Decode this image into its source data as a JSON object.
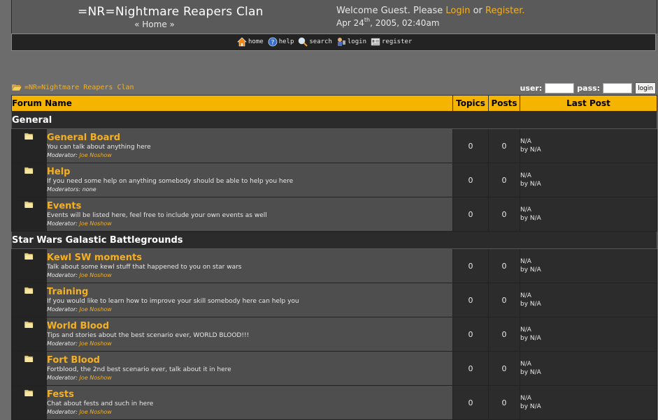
{
  "header": {
    "site_title": "=NR=Nightmare Reapers Clan",
    "home_link": "« Home »",
    "welcome_prefix": "Welcome Guest. Please ",
    "login_link": "Login",
    "or_text": " or ",
    "register_link": "Register.",
    "date_main": "Apr 24",
    "date_suffix": "th",
    "date_rest": ", 2005, 02:40am"
  },
  "nav": [
    {
      "label": "home",
      "icon": "home-icon"
    },
    {
      "label": "help",
      "icon": "help-icon"
    },
    {
      "label": "search",
      "icon": "search-icon"
    },
    {
      "label": "login",
      "icon": "login-icon"
    },
    {
      "label": "register",
      "icon": "register-icon"
    }
  ],
  "breadcrumb": {
    "text": "=NR=Nightmare Reapers Clan"
  },
  "login_form": {
    "user_label": "user:",
    "pass_label": "pass:",
    "button": "login"
  },
  "table_headers": {
    "forum_name": "Forum Name",
    "topics": "Topics",
    "posts": "Posts",
    "last_post": "Last Post"
  },
  "categories": [
    {
      "name": "General",
      "forums": [
        {
          "title": "General Board",
          "desc": "You can talk about anything here",
          "mod_label": "Moderator:",
          "mod": "Joe Noshow",
          "topics": "0",
          "posts": "0",
          "last1": "N/A",
          "last2": "by N/A"
        },
        {
          "title": "Help",
          "desc": "If you need some help on anything somebody should be able to help you here",
          "mod_label": "Moderators:",
          "mod": "none",
          "topics": "0",
          "posts": "0",
          "last1": "N/A",
          "last2": "by N/A"
        },
        {
          "title": "Events",
          "desc": "Events will be listed here, feel free to include your own events as well",
          "mod_label": "Moderator:",
          "mod": "Joe Noshow",
          "topics": "0",
          "posts": "0",
          "last1": "N/A",
          "last2": "by N/A"
        }
      ]
    },
    {
      "name": "Star Wars Galastic Battlegrounds",
      "forums": [
        {
          "title": "Kewl SW moments",
          "desc": "Talk about some kewl stuff that happened to you on star wars",
          "mod_label": "Moderator:",
          "mod": "Joe Noshow",
          "topics": "0",
          "posts": "0",
          "last1": "N/A",
          "last2": "by N/A"
        },
        {
          "title": "Training",
          "desc": "If you would like to learn how to improve your skill somebody here can help you",
          "mod_label": "Moderator:",
          "mod": "Joe Noshow",
          "topics": "0",
          "posts": "0",
          "last1": "N/A",
          "last2": "by N/A"
        },
        {
          "title": "World Blood",
          "desc": "Tips and stories about the best scenario ever, WORLD BLOOD!!!",
          "mod_label": "Moderator:",
          "mod": "Joe Noshow",
          "topics": "0",
          "posts": "0",
          "last1": "N/A",
          "last2": "by N/A"
        },
        {
          "title": "Fort Blood",
          "desc": "Fortblood, the 2nd best scenario ever, talk about it in here",
          "mod_label": "Moderator:",
          "mod": "Joe Noshow",
          "topics": "0",
          "posts": "0",
          "last1": "N/A",
          "last2": "by N/A"
        },
        {
          "title": "Fests",
          "desc": "Chat about fests and such in here",
          "mod_label": "Moderator:",
          "mod": "Joe Noshow",
          "topics": "0",
          "posts": "0",
          "last1": "N/A",
          "last2": "by N/A"
        }
      ]
    }
  ],
  "colors": {
    "accent": "#f5b022",
    "header_bg": "#f5b400",
    "page_bg": "#6c6c6c"
  }
}
